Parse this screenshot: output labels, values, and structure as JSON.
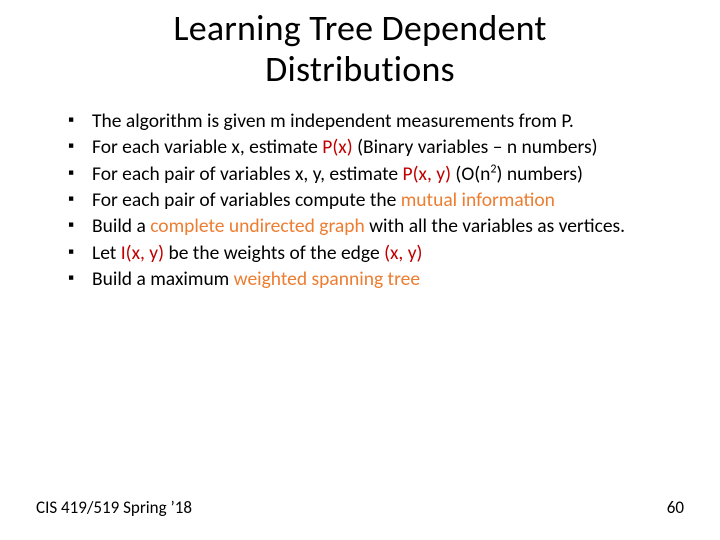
{
  "title_line1": "Learning Tree Dependent",
  "title_line2": "Distributions",
  "bullets": {
    "b1_a": "The algorithm is given m independent measurements  from P.",
    "b2_a": "For each variable x, estimate ",
    "b2_px": "P(x)",
    "b2_b": "   (Binary variables – n numbers)",
    "b3_a": "For each pair of variables x, y, estimate ",
    "b3_pxy": "P(x, y)",
    "b3_b": " (O(n",
    "b3_sup": "2",
    "b3_c": ") numbers)",
    "b4_a": "For each pair of variables compute  the ",
    "b4_mi": "mutual information",
    "b5_a": "Build a ",
    "b5_cug": "complete undirected graph",
    "b5_b": " with all the variables as vertices.",
    "b6_a": "Let ",
    "b6_ixy": "I(x, y)",
    "b6_b": " be the weights of the edge ",
    "b6_edge": "(x, y)",
    "b7_a": "Build a maximum ",
    "b7_wst": "weighted spanning tree"
  },
  "footer_left": "CIS 419/519 Spring ’18",
  "footer_right": "60"
}
